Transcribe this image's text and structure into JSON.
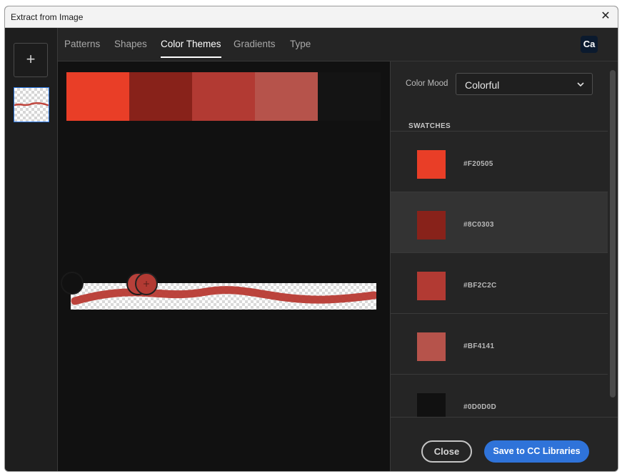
{
  "window": {
    "title": "Extract from Image",
    "close_icon": "close-icon"
  },
  "leftbar": {
    "add_label": "+"
  },
  "tabs": [
    {
      "label": "Patterns",
      "active": false
    },
    {
      "label": "Shapes",
      "active": false
    },
    {
      "label": "Color Themes",
      "active": true
    },
    {
      "label": "Gradients",
      "active": false
    },
    {
      "label": "Type",
      "active": false
    }
  ],
  "app_logo": "Ca",
  "palette_colors": [
    "#E93E27",
    "#88221A",
    "#B23A33",
    "#B6534B"
  ],
  "color_mood": {
    "label": "Color Mood",
    "value": "Colorful"
  },
  "swatches": {
    "heading": "SWATCHES",
    "items": [
      {
        "hex": "#F20505",
        "display": "#E93E27",
        "selected": false
      },
      {
        "hex": "#8C0303",
        "display": "#88221A",
        "selected": true
      },
      {
        "hex": "#BF2C2C",
        "display": "#B23A33",
        "selected": false
      },
      {
        "hex": "#BF4141",
        "display": "#B6534B",
        "selected": false
      },
      {
        "hex": "#0D0D0D",
        "display": "#111111",
        "selected": false
      }
    ]
  },
  "footer": {
    "close_label": "Close",
    "save_label": "Save to CC Libraries"
  },
  "accent_color": "#2F73D9"
}
